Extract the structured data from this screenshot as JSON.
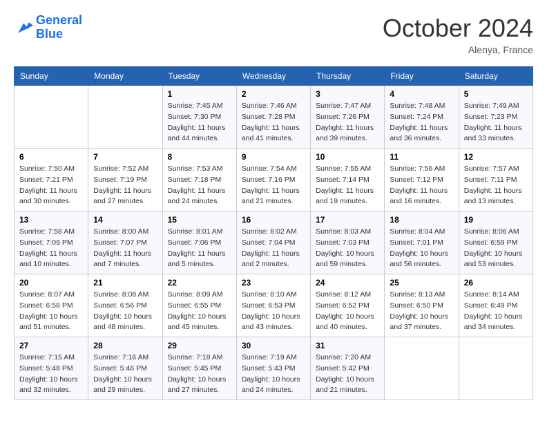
{
  "header": {
    "logo_line1": "General",
    "logo_line2": "Blue",
    "month_title": "October 2024",
    "location": "Alenya, France"
  },
  "weekdays": [
    "Sunday",
    "Monday",
    "Tuesday",
    "Wednesday",
    "Thursday",
    "Friday",
    "Saturday"
  ],
  "weeks": [
    [
      {
        "day": "",
        "sunrise": "",
        "sunset": "",
        "daylight": ""
      },
      {
        "day": "",
        "sunrise": "",
        "sunset": "",
        "daylight": ""
      },
      {
        "day": "1",
        "sunrise": "Sunrise: 7:45 AM",
        "sunset": "Sunset: 7:30 PM",
        "daylight": "Daylight: 11 hours and 44 minutes."
      },
      {
        "day": "2",
        "sunrise": "Sunrise: 7:46 AM",
        "sunset": "Sunset: 7:28 PM",
        "daylight": "Daylight: 11 hours and 41 minutes."
      },
      {
        "day": "3",
        "sunrise": "Sunrise: 7:47 AM",
        "sunset": "Sunset: 7:26 PM",
        "daylight": "Daylight: 11 hours and 39 minutes."
      },
      {
        "day": "4",
        "sunrise": "Sunrise: 7:48 AM",
        "sunset": "Sunset: 7:24 PM",
        "daylight": "Daylight: 11 hours and 36 minutes."
      },
      {
        "day": "5",
        "sunrise": "Sunrise: 7:49 AM",
        "sunset": "Sunset: 7:23 PM",
        "daylight": "Daylight: 11 hours and 33 minutes."
      }
    ],
    [
      {
        "day": "6",
        "sunrise": "Sunrise: 7:50 AM",
        "sunset": "Sunset: 7:21 PM",
        "daylight": "Daylight: 11 hours and 30 minutes."
      },
      {
        "day": "7",
        "sunrise": "Sunrise: 7:52 AM",
        "sunset": "Sunset: 7:19 PM",
        "daylight": "Daylight: 11 hours and 27 minutes."
      },
      {
        "day": "8",
        "sunrise": "Sunrise: 7:53 AM",
        "sunset": "Sunset: 7:18 PM",
        "daylight": "Daylight: 11 hours and 24 minutes."
      },
      {
        "day": "9",
        "sunrise": "Sunrise: 7:54 AM",
        "sunset": "Sunset: 7:16 PM",
        "daylight": "Daylight: 11 hours and 21 minutes."
      },
      {
        "day": "10",
        "sunrise": "Sunrise: 7:55 AM",
        "sunset": "Sunset: 7:14 PM",
        "daylight": "Daylight: 11 hours and 19 minutes."
      },
      {
        "day": "11",
        "sunrise": "Sunrise: 7:56 AM",
        "sunset": "Sunset: 7:12 PM",
        "daylight": "Daylight: 11 hours and 16 minutes."
      },
      {
        "day": "12",
        "sunrise": "Sunrise: 7:57 AM",
        "sunset": "Sunset: 7:11 PM",
        "daylight": "Daylight: 11 hours and 13 minutes."
      }
    ],
    [
      {
        "day": "13",
        "sunrise": "Sunrise: 7:58 AM",
        "sunset": "Sunset: 7:09 PM",
        "daylight": "Daylight: 11 hours and 10 minutes."
      },
      {
        "day": "14",
        "sunrise": "Sunrise: 8:00 AM",
        "sunset": "Sunset: 7:07 PM",
        "daylight": "Daylight: 11 hours and 7 minutes."
      },
      {
        "day": "15",
        "sunrise": "Sunrise: 8:01 AM",
        "sunset": "Sunset: 7:06 PM",
        "daylight": "Daylight: 11 hours and 5 minutes."
      },
      {
        "day": "16",
        "sunrise": "Sunrise: 8:02 AM",
        "sunset": "Sunset: 7:04 PM",
        "daylight": "Daylight: 11 hours and 2 minutes."
      },
      {
        "day": "17",
        "sunrise": "Sunrise: 8:03 AM",
        "sunset": "Sunset: 7:03 PM",
        "daylight": "Daylight: 10 hours and 59 minutes."
      },
      {
        "day": "18",
        "sunrise": "Sunrise: 8:04 AM",
        "sunset": "Sunset: 7:01 PM",
        "daylight": "Daylight: 10 hours and 56 minutes."
      },
      {
        "day": "19",
        "sunrise": "Sunrise: 8:06 AM",
        "sunset": "Sunset: 6:59 PM",
        "daylight": "Daylight: 10 hours and 53 minutes."
      }
    ],
    [
      {
        "day": "20",
        "sunrise": "Sunrise: 8:07 AM",
        "sunset": "Sunset: 6:58 PM",
        "daylight": "Daylight: 10 hours and 51 minutes."
      },
      {
        "day": "21",
        "sunrise": "Sunrise: 8:08 AM",
        "sunset": "Sunset: 6:56 PM",
        "daylight": "Daylight: 10 hours and 48 minutes."
      },
      {
        "day": "22",
        "sunrise": "Sunrise: 8:09 AM",
        "sunset": "Sunset: 6:55 PM",
        "daylight": "Daylight: 10 hours and 45 minutes."
      },
      {
        "day": "23",
        "sunrise": "Sunrise: 8:10 AM",
        "sunset": "Sunset: 6:53 PM",
        "daylight": "Daylight: 10 hours and 43 minutes."
      },
      {
        "day": "24",
        "sunrise": "Sunrise: 8:12 AM",
        "sunset": "Sunset: 6:52 PM",
        "daylight": "Daylight: 10 hours and 40 minutes."
      },
      {
        "day": "25",
        "sunrise": "Sunrise: 8:13 AM",
        "sunset": "Sunset: 6:50 PM",
        "daylight": "Daylight: 10 hours and 37 minutes."
      },
      {
        "day": "26",
        "sunrise": "Sunrise: 8:14 AM",
        "sunset": "Sunset: 6:49 PM",
        "daylight": "Daylight: 10 hours and 34 minutes."
      }
    ],
    [
      {
        "day": "27",
        "sunrise": "Sunrise: 7:15 AM",
        "sunset": "Sunset: 5:48 PM",
        "daylight": "Daylight: 10 hours and 32 minutes."
      },
      {
        "day": "28",
        "sunrise": "Sunrise: 7:16 AM",
        "sunset": "Sunset: 5:46 PM",
        "daylight": "Daylight: 10 hours and 29 minutes."
      },
      {
        "day": "29",
        "sunrise": "Sunrise: 7:18 AM",
        "sunset": "Sunset: 5:45 PM",
        "daylight": "Daylight: 10 hours and 27 minutes."
      },
      {
        "day": "30",
        "sunrise": "Sunrise: 7:19 AM",
        "sunset": "Sunset: 5:43 PM",
        "daylight": "Daylight: 10 hours and 24 minutes."
      },
      {
        "day": "31",
        "sunrise": "Sunrise: 7:20 AM",
        "sunset": "Sunset: 5:42 PM",
        "daylight": "Daylight: 10 hours and 21 minutes."
      },
      {
        "day": "",
        "sunrise": "",
        "sunset": "",
        "daylight": ""
      },
      {
        "day": "",
        "sunrise": "",
        "sunset": "",
        "daylight": ""
      }
    ]
  ]
}
